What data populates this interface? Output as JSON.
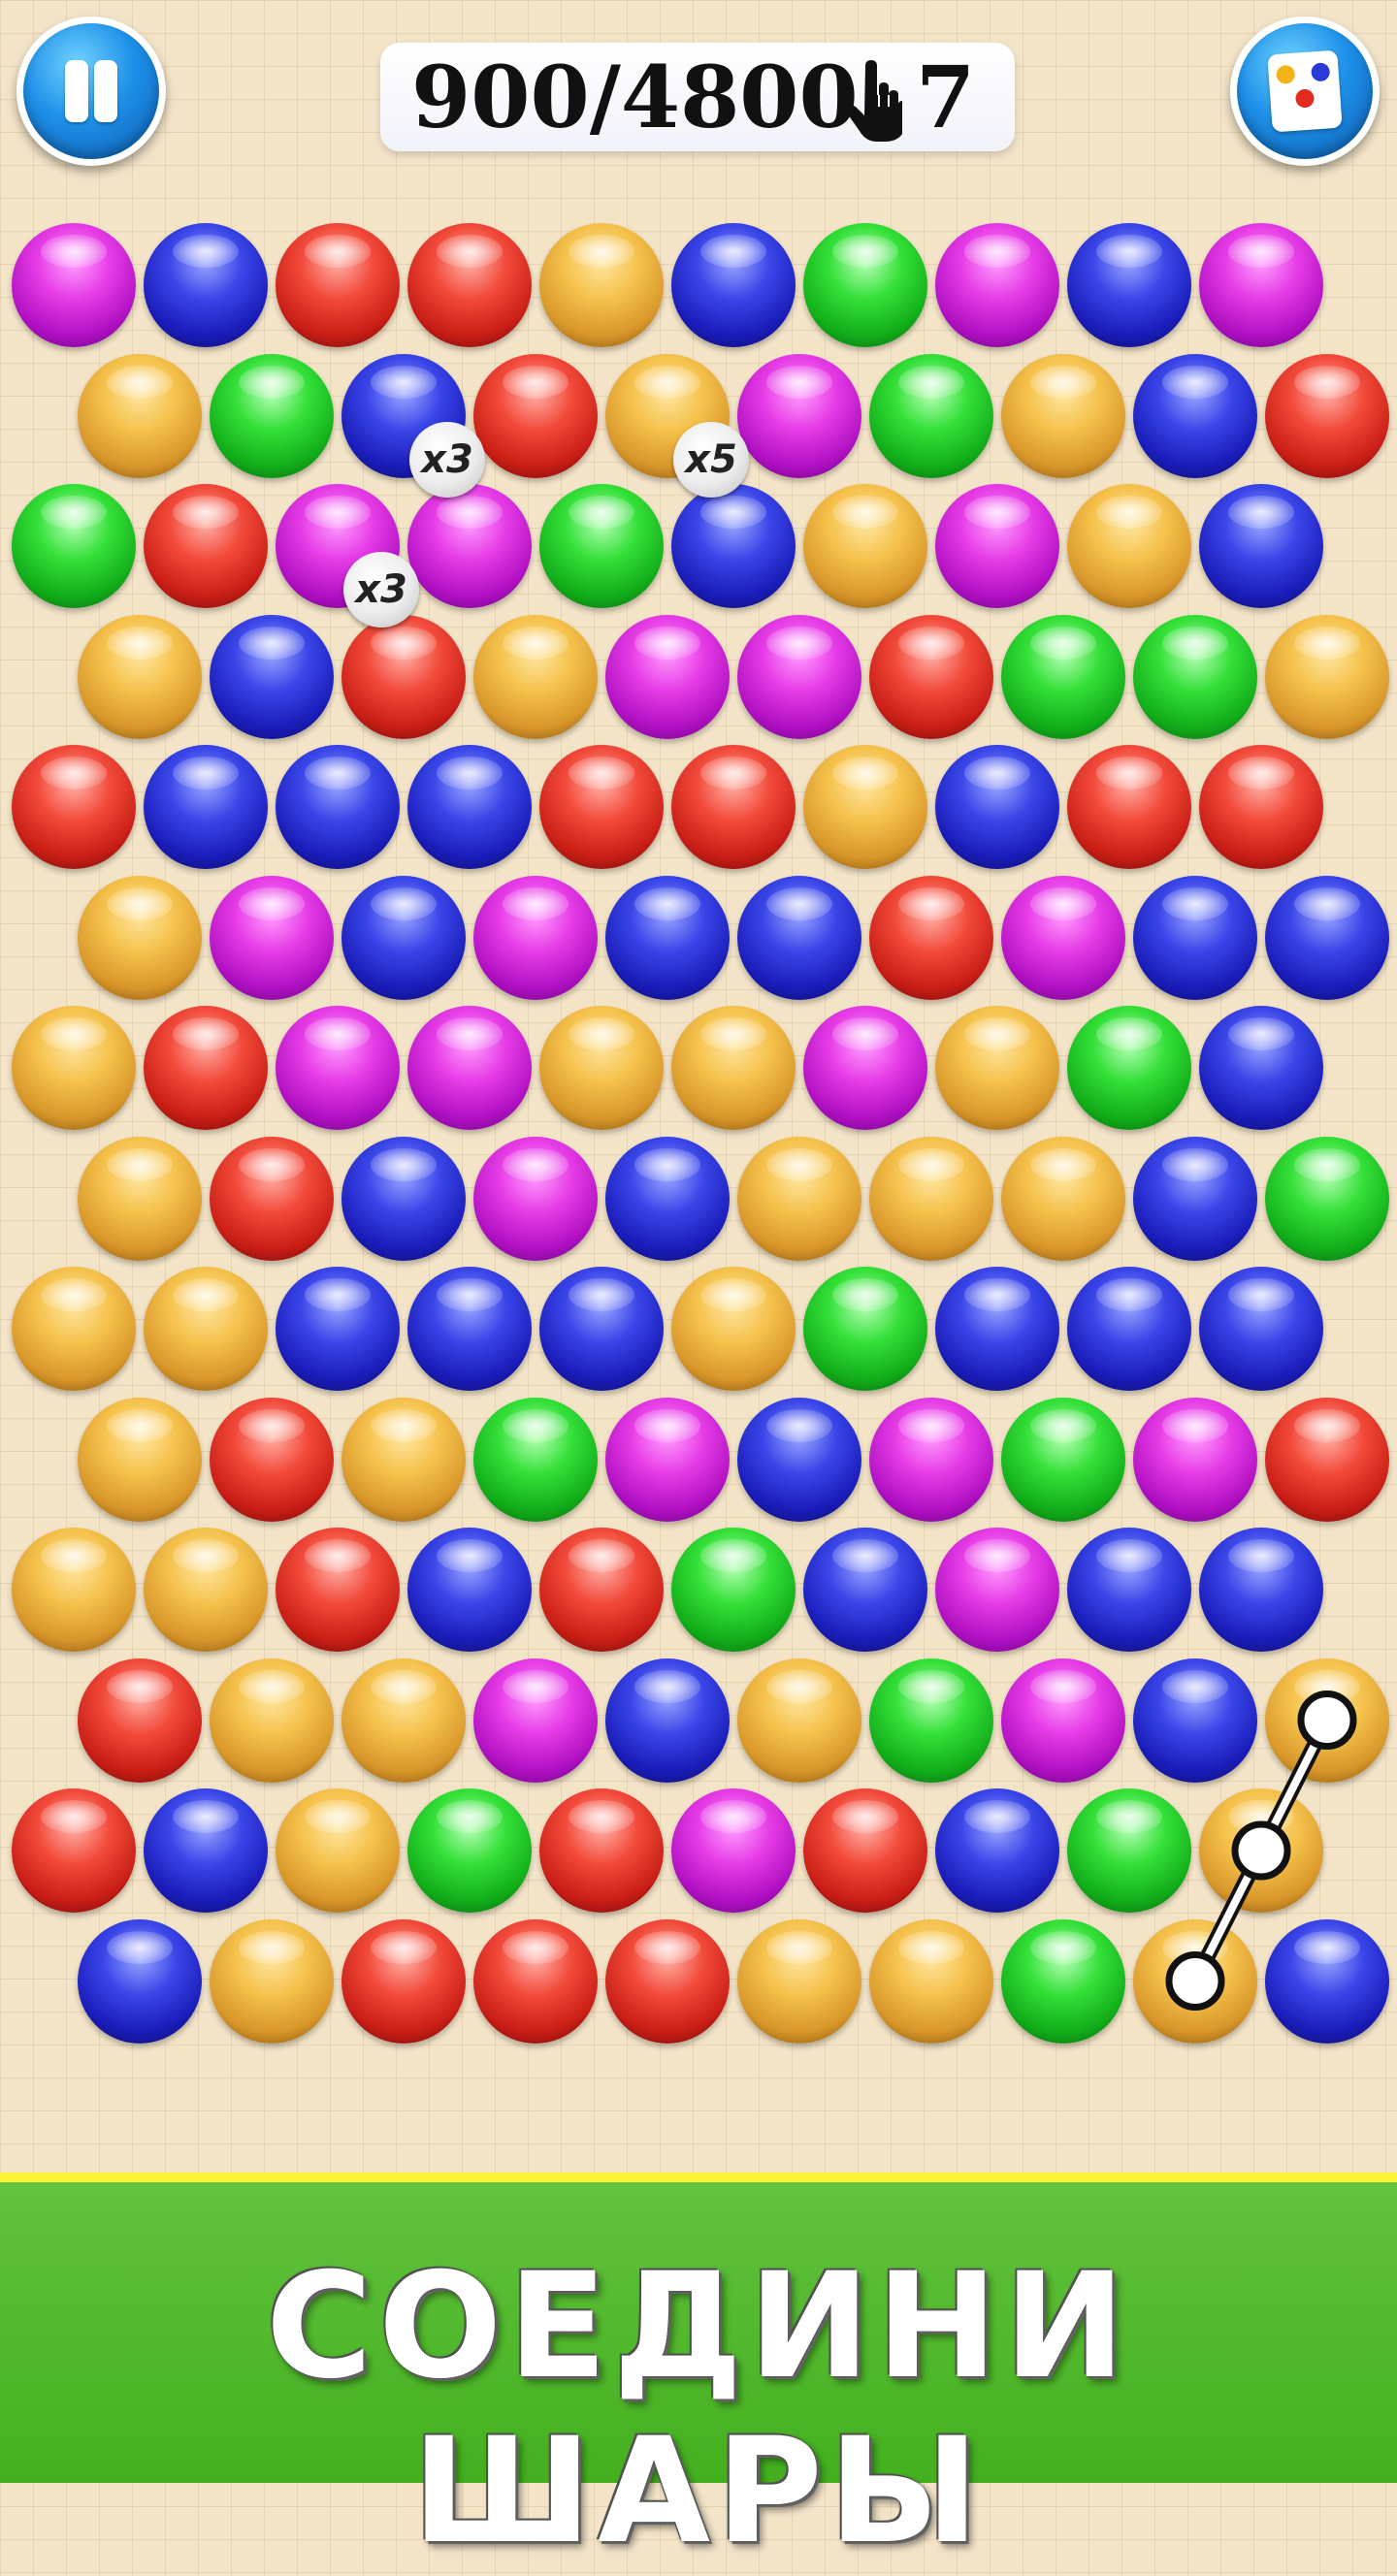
{
  "hud": {
    "score_text": "900/4800",
    "moves_text": "7",
    "hand_icon": "pointing-hand-icon",
    "pause_icon": "pause-icon",
    "colors_icon": "color-cards-icon"
  },
  "board": {
    "colors": {
      "p": "#d21ed6",
      "b": "#2530d6",
      "r": "#e0281e",
      "y": "#eeb23a",
      "g": "#1fcf24"
    },
    "rows": [
      "pbrrybgpbp",
      "ygbrypgybr",
      "grppgbypyb",
      "ybrypprggy",
      "rbbbrrybrr",
      "ypbpbbrpbb",
      "yrppyypygb",
      "yrbpbyyybg",
      "yybbbygbbb",
      "yrygpbpgpr",
      "yyrbrgbpbb",
      "ryypbygpby",
      "rbygrprbgy",
      "byrrryygyb"
    ],
    "multipliers": [
      {
        "row": 1,
        "col": 2,
        "label": "x3"
      },
      {
        "row": 1,
        "col": 4,
        "label": "x5"
      },
      {
        "row": 2,
        "col": 2,
        "label": "x3"
      }
    ],
    "hint_path": [
      {
        "row": 11,
        "col": 9
      },
      {
        "row": 12,
        "col": 9
      },
      {
        "row": 13,
        "col": 8
      }
    ]
  },
  "banner": {
    "text": "СОЕДИНИ ШАРЫ"
  }
}
